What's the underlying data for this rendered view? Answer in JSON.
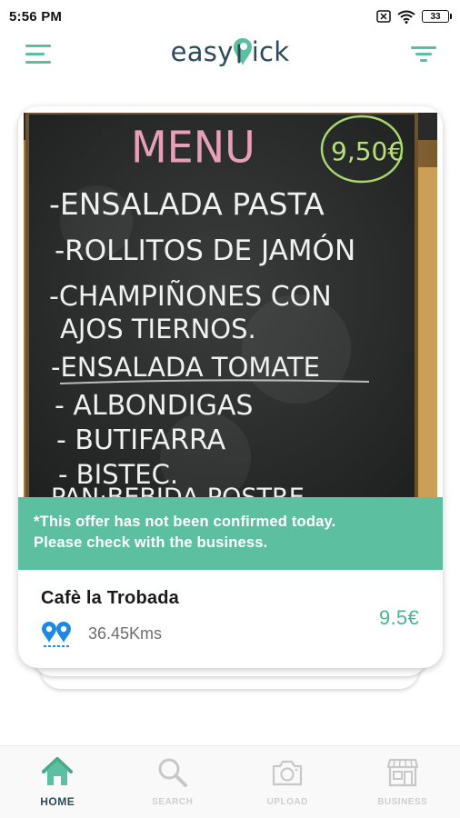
{
  "status_bar": {
    "time": "5:56 PM",
    "battery": "33",
    "icons": [
      "sim-off-icon",
      "wifi-icon",
      "battery-icon"
    ]
  },
  "header": {
    "logo_prefix": "easy",
    "logo_suffix": "ick",
    "icons": [
      "hamburger-menu-icon",
      "filter-icon"
    ]
  },
  "card": {
    "menu_board": {
      "title": "MENU",
      "price_tag": "9,50€",
      "lines": [
        "-ENSALADA PASTA",
        "-ROLLITOS DE JAMÓN",
        "-CHAMPIÑONES CON",
        "AJOS TIERNOS.",
        "-ENSALADA TOMATE",
        "- ALBONDIGAS",
        "- BUTIFARRA",
        "- BISTEC.",
        "PAN·BEBIDA-POSTRE"
      ]
    },
    "offer_notice_line1": "*This offer has not been confirmed today.",
    "offer_notice_line2": "Please check with the business.",
    "business_name": "Cafè la Trobada",
    "distance": "36.45Kms",
    "price": "9.5€"
  },
  "bottom_nav": {
    "items": [
      {
        "label": "HOME",
        "icon": "home-icon",
        "active": true
      },
      {
        "label": "SEARCH",
        "icon": "search-icon",
        "active": false
      },
      {
        "label": "UPLOAD",
        "icon": "camera-icon",
        "active": false
      },
      {
        "label": "BUSINESS",
        "icon": "store-icon",
        "active": false
      }
    ]
  },
  "colors": {
    "accent": "#5cbfa0",
    "price": "#4ab493",
    "logo": "#2c4a5a",
    "location_pin": "#1e88e5"
  }
}
